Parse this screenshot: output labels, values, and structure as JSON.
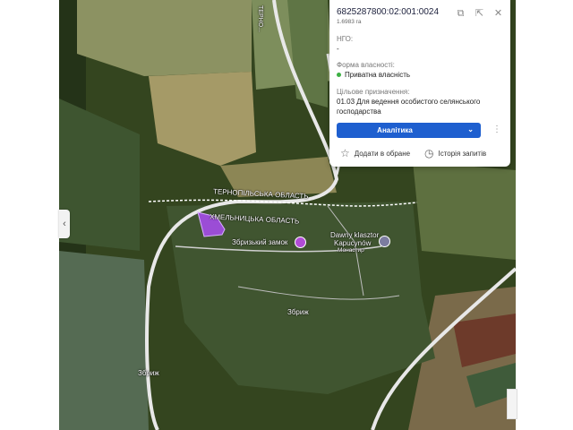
{
  "parcel": {
    "cadastral_number": "6825287800:02:001:0024",
    "area": "1.6983 га",
    "ngo_label": "НГО:",
    "ngo_value": "-",
    "ownership_label": "Форма власності:",
    "ownership_value": "Приватна власність",
    "ownership_color": "#3cb043",
    "purpose_label": "Цільове призначення:",
    "purpose_value_line1": "01.03 Для ведення особистого селянського",
    "purpose_value_line2": "господарства"
  },
  "actions": {
    "analytics_label": "Аналітика",
    "favorite_label": "Додати в обране",
    "history_label": "Історія запитів"
  },
  "map": {
    "labels": {
      "ternopil_oblast": "ТЕРНОПІЛЬСЬКА ОБЛАСТЬ",
      "khmelnytska_oblast": "ХМЕЛЬНИЦЬКА ОБЛАСТЬ",
      "castle": "Збризький замок",
      "monastery_line1": "Dawny klasztor",
      "monastery_line2": "Kapucynów",
      "monastery_line3": "Монастир",
      "village_center": "Збриж",
      "village_left": "Збриж",
      "road_vertical": "ТЕРНО..."
    }
  },
  "colors": {
    "accent": "#1e5fcf",
    "parcel_fill": "#9b4dd6",
    "border_line": "#ffffff"
  }
}
